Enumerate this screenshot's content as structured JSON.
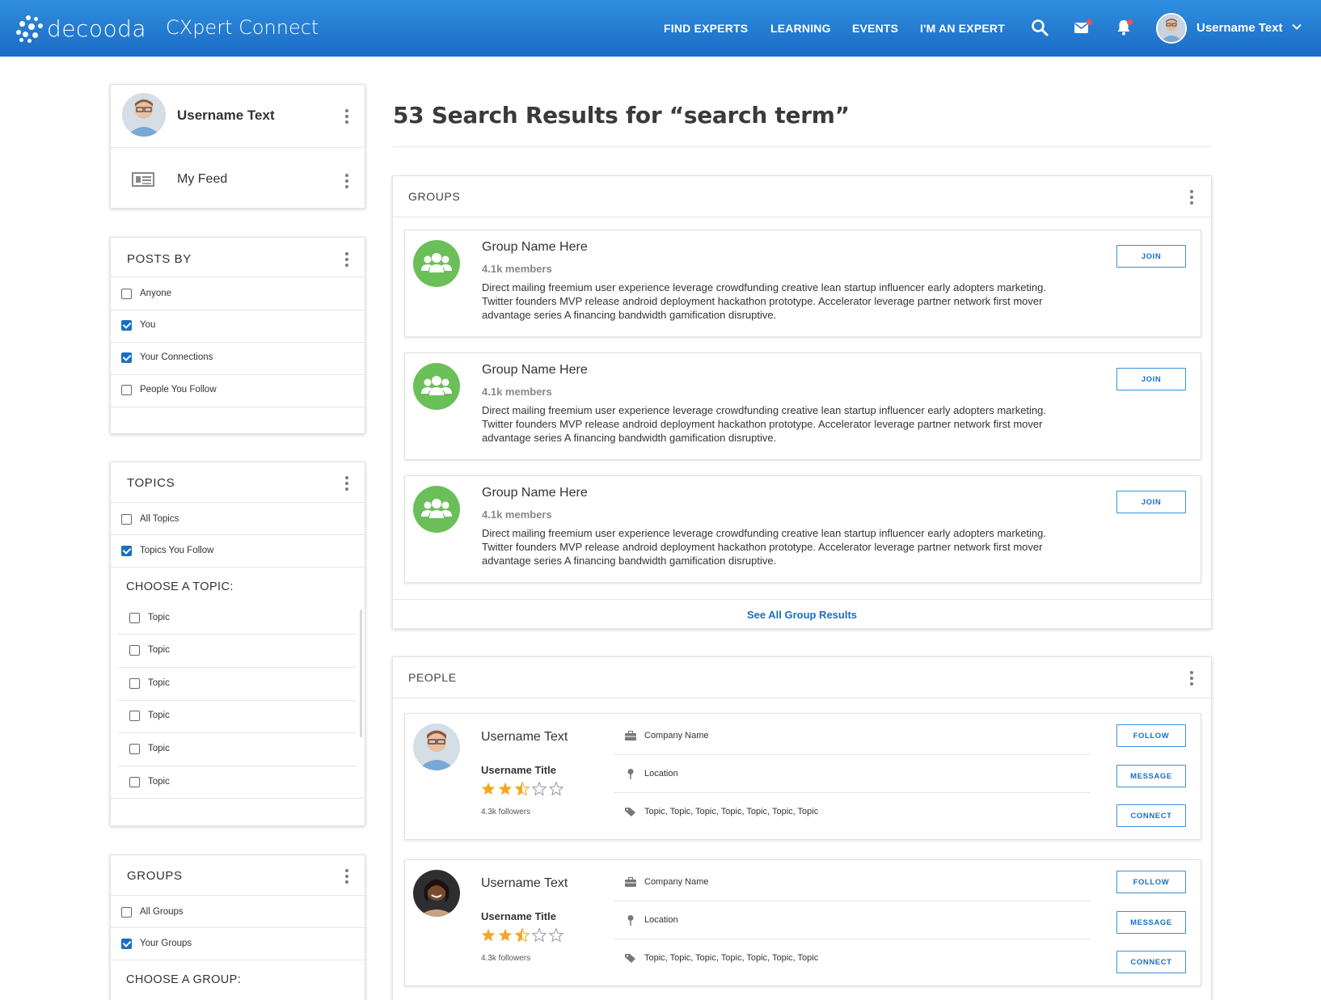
{
  "header": {
    "logo_text": "decooda",
    "app_name": "CXpert Connect",
    "nav": [
      "FIND EXPERTS",
      "LEARNING",
      "EVENTS",
      "I'M AN EXPERT"
    ],
    "username": "Username Text"
  },
  "sidebar": {
    "profile": {
      "username": "Username Text",
      "feed_label": "My Feed"
    },
    "posts_by": {
      "title": "POSTS BY",
      "options": [
        {
          "label": "Anyone",
          "checked": false
        },
        {
          "label": "You",
          "checked": true
        },
        {
          "label": "Your Connections",
          "checked": true
        },
        {
          "label": "People You Follow",
          "checked": false
        }
      ]
    },
    "topics": {
      "title": "TOPICS",
      "options": [
        {
          "label": "All Topics",
          "checked": false
        },
        {
          "label": "Topics You Follow",
          "checked": true
        }
      ],
      "choose_label": "CHOOSE A TOPIC:",
      "topic_list": [
        "Topic",
        "Topic",
        "Topic",
        "Topic",
        "Topic",
        "Topic"
      ]
    },
    "groups": {
      "title": "GROUPS",
      "options": [
        {
          "label": "All Groups",
          "checked": false
        },
        {
          "label": "Your Groups",
          "checked": true
        }
      ],
      "choose_label": "CHOOSE A GROUP:"
    }
  },
  "main": {
    "title": "53 Search Results for “search term”",
    "groups_section": {
      "title": "GROUPS",
      "items": [
        {
          "name": "Group Name Here",
          "members": "4.1k members",
          "description": "Direct mailing freemium user experience leverage crowdfunding creative lean startup influencer early adopters marketing. Twitter founders MVP release android deployment hackathon prototype. Accelerator leverage partner network first mover advantage series A financing bandwidth gamification disruptive.",
          "button": "JOIN"
        },
        {
          "name": "Group Name Here",
          "members": "4.1k members",
          "description": "Direct mailing freemium user experience leverage crowdfunding creative lean startup influencer early adopters marketing. Twitter founders MVP release android deployment hackathon prototype. Accelerator leverage partner network first mover advantage series A financing bandwidth gamification disruptive.",
          "button": "JOIN"
        },
        {
          "name": "Group Name Here",
          "members": "4.1k members",
          "description": "Direct mailing freemium user experience leverage crowdfunding creative lean startup influencer early adopters marketing. Twitter founders MVP release android deployment hackathon prototype. Accelerator leverage partner network first mover advantage series A financing bandwidth gamification disruptive.",
          "button": "JOIN"
        }
      ],
      "see_all": "See All Group Results"
    },
    "people_section": {
      "title": "PEOPLE",
      "items": [
        {
          "name": "Username Text",
          "title": "Username Title",
          "rating": 2.5,
          "followers": "4.3k followers",
          "company": "Company Name",
          "location": "Location",
          "topics": "Topic, Topic, Topic, Topic, Topic, Topic, Topic",
          "buttons": [
            "FOLLOW",
            "MESSAGE",
            "CONNECT"
          ]
        },
        {
          "name": "Username Text",
          "title": "Username Title",
          "rating": 2.5,
          "followers": "4.3k followers",
          "company": "Company Name",
          "location": "Location",
          "topics": "Topic, Topic, Topic, Topic, Topic, Topic, Topic",
          "buttons": [
            "FOLLOW",
            "MESSAGE",
            "CONNECT"
          ]
        }
      ]
    }
  },
  "colors": {
    "header": "#1f74c9",
    "accent": "#1a6fc3",
    "group_icon": "#6bbf59",
    "star": "#f5a623"
  }
}
